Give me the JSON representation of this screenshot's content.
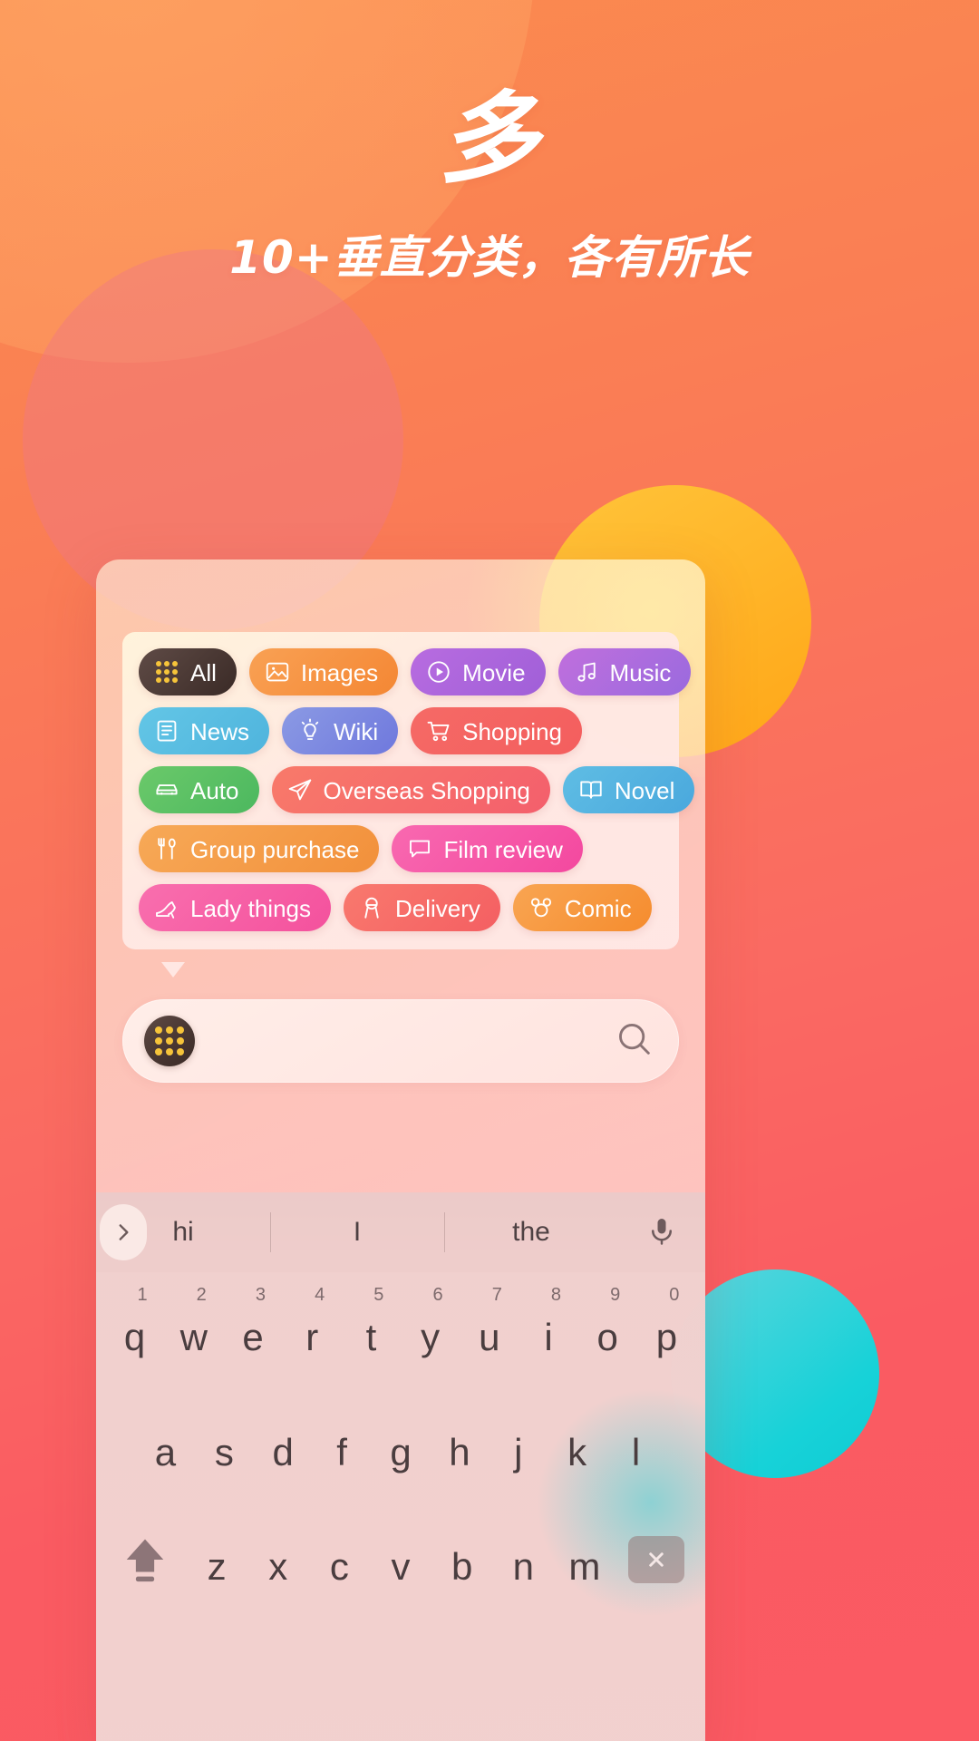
{
  "hero": {
    "headline_char": "多",
    "subtitle": "10+垂直分类，各有所长"
  },
  "colors": {
    "background_start": "#fb8c4e",
    "background_end": "#fb5a63",
    "accent_yellow": "#ffb225",
    "accent_teal": "#17d2d8",
    "chip_text": "#ffffff"
  },
  "categories": {
    "rows": [
      [
        {
          "label": "All",
          "icon": "dot-grid-icon",
          "color_start": "#5f4b46",
          "color_end": "#3a2a26"
        },
        {
          "label": "Images",
          "icon": "image-icon",
          "color_start": "#f9a154",
          "color_end": "#f48734"
        },
        {
          "label": "Movie",
          "icon": "play-circle-icon",
          "color_start": "#b86ce0",
          "color_end": "#a05fd8"
        },
        {
          "label": "Music",
          "icon": "music-note-icon",
          "color_start": "#c06fdd",
          "color_end": "#9a6ade"
        }
      ],
      [
        {
          "label": "News",
          "icon": "newspaper-icon",
          "color_start": "#63c6e6",
          "color_end": "#4fb4dd"
        },
        {
          "label": "Wiki",
          "icon": "lightbulb-icon",
          "color_start": "#8b9ae4",
          "color_end": "#6f78dd"
        },
        {
          "label": "Shopping",
          "icon": "cart-icon",
          "color_start": "#f56a66",
          "color_end": "#f45e5e"
        }
      ],
      [
        {
          "label": "Auto",
          "icon": "car-icon",
          "color_start": "#6bc96a",
          "color_end": "#4cb85f"
        },
        {
          "label": "Overseas Shopping",
          "icon": "paper-plane-icon",
          "color_start": "#f87a6a",
          "color_end": "#f45f6c"
        },
        {
          "label": "Novel",
          "icon": "book-icon",
          "color_start": "#5fbde4",
          "color_end": "#4aa8dd"
        }
      ],
      [
        {
          "label": "Group purchase",
          "icon": "fork-spoon-icon",
          "color_start": "#f7a957",
          "color_end": "#f2903b"
        },
        {
          "label": "Film review",
          "icon": "chat-bubble-icon",
          "color_start": "#f869b0",
          "color_end": "#f4489f"
        }
      ],
      [
        {
          "label": "Lady things",
          "icon": "high-heel-icon",
          "color_start": "#f96fae",
          "color_end": "#f4519d"
        },
        {
          "label": "Delivery",
          "icon": "delivery-rider-icon",
          "color_start": "#f9796e",
          "color_end": "#f45f62"
        },
        {
          "label": "Comic",
          "icon": "mouse-head-icon",
          "color_start": "#f9a552",
          "color_end": "#f58c2e"
        }
      ]
    ]
  },
  "search": {
    "badge_icon": "dot-grid-icon",
    "value": "",
    "placeholder": "",
    "search_icon": "search-icon"
  },
  "keyboard": {
    "expand_icon": "chevron-right-icon",
    "suggestions": [
      "hi",
      "I",
      "the"
    ],
    "mic_icon": "microphone-icon",
    "row1": [
      {
        "letter": "q",
        "num": "1"
      },
      {
        "letter": "w",
        "num": "2"
      },
      {
        "letter": "e",
        "num": "3"
      },
      {
        "letter": "r",
        "num": "4"
      },
      {
        "letter": "t",
        "num": "5"
      },
      {
        "letter": "y",
        "num": "6"
      },
      {
        "letter": "u",
        "num": "7"
      },
      {
        "letter": "i",
        "num": "8"
      },
      {
        "letter": "o",
        "num": "9"
      },
      {
        "letter": "p",
        "num": "0"
      }
    ],
    "row2": [
      {
        "letter": "a"
      },
      {
        "letter": "s"
      },
      {
        "letter": "d"
      },
      {
        "letter": "f"
      },
      {
        "letter": "g"
      },
      {
        "letter": "h"
      },
      {
        "letter": "j"
      },
      {
        "letter": "k"
      },
      {
        "letter": "l"
      }
    ],
    "row3": [
      {
        "letter": "z"
      },
      {
        "letter": "x"
      },
      {
        "letter": "c"
      },
      {
        "letter": "v"
      },
      {
        "letter": "b"
      },
      {
        "letter": "n"
      },
      {
        "letter": "m"
      }
    ],
    "shift_icon": "shift-icon",
    "delete_icon": "backspace-icon"
  }
}
